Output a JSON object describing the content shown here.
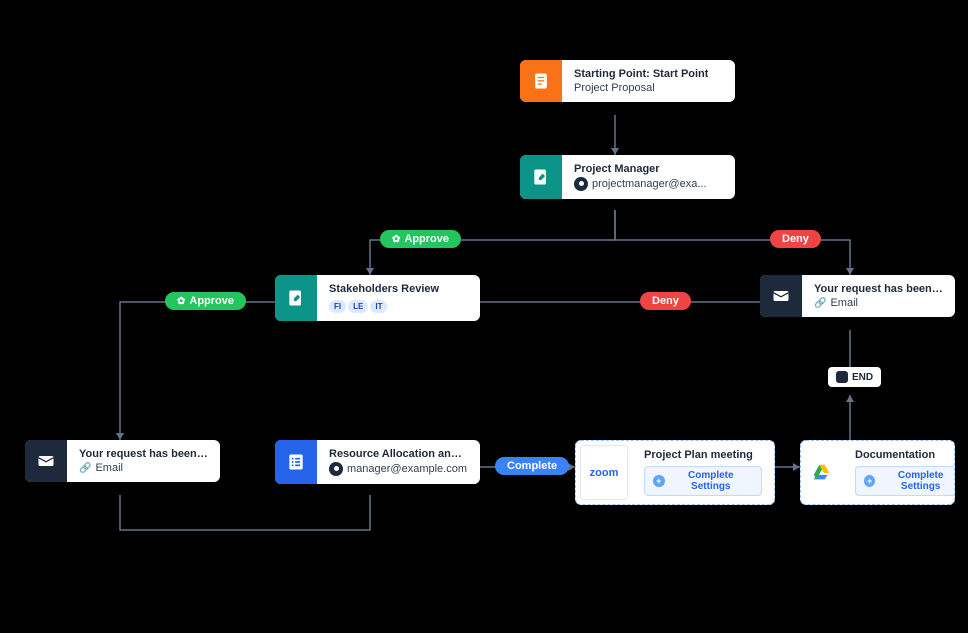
{
  "nodes": {
    "start": {
      "title": "Starting Point: Start Point",
      "sub": "Project Proposal"
    },
    "pm": {
      "title": "Project Manager",
      "sub": "projectmanager@exa..."
    },
    "stakeholders": {
      "title": "Stakeholders Review",
      "badges": [
        "FI",
        "LE",
        "IT"
      ]
    },
    "denied": {
      "title": "Your request has been denied.",
      "sub": "Email"
    },
    "accepted": {
      "title": "Your request has been accep...",
      "sub": "Email"
    },
    "resource": {
      "title": "Resource Allocation and Sch...",
      "sub": "manager@example.com"
    },
    "meeting": {
      "title": "Project Plan meeting",
      "button": "Complete Settings"
    },
    "docs": {
      "title": "Documentation",
      "button": "Complete Settings"
    }
  },
  "pills": {
    "approve1": "Approve",
    "deny1": "Deny",
    "approve2": "Approve",
    "deny2": "Deny",
    "complete": "Complete"
  },
  "end_label": "END",
  "icons": {
    "zoom": "zoom"
  }
}
